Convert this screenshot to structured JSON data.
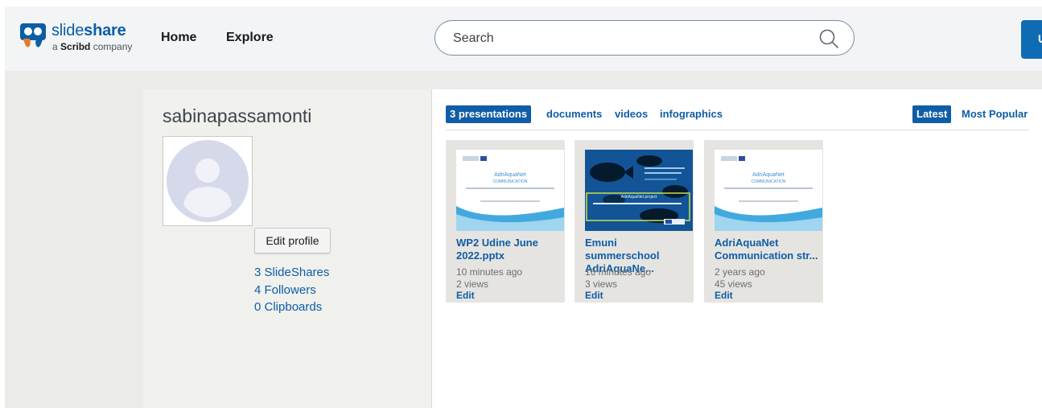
{
  "header": {
    "logo": {
      "brand_light": "slide",
      "brand_bold": "share",
      "sub_prefix": "a ",
      "sub_bold": "Scribd",
      "sub_suffix": " company"
    },
    "nav": [
      "Home",
      "Explore"
    ],
    "search": {
      "placeholder": "Search",
      "icon": "search-icon"
    },
    "upload_label": "U"
  },
  "profile": {
    "username": "sabinapassamonti",
    "edit_label": "Edit profile",
    "stats": [
      "3 SlideShares",
      "4 Followers",
      "0 Clipboards"
    ]
  },
  "tabs": {
    "content": [
      "3 presentations",
      "documents",
      "videos",
      "infographics"
    ],
    "active": "3 presentations",
    "sort": [
      "Latest",
      "Most Popular"
    ],
    "active_sort": "Latest"
  },
  "presentations": [
    {
      "title": "WP2 Udine June 2022.pptx",
      "time": "10 minutes ago",
      "views": "2 views",
      "action": "Edit",
      "thumb": {
        "style": "light",
        "heading": "AdriAquaNet",
        "subheading": "COMMUNICATION"
      }
    },
    {
      "title": "Emuni summerschool AdriAquaNe...",
      "time": "16 minutes ago",
      "views": "3 views",
      "action": "Edit",
      "thumb": {
        "style": "dark",
        "heading": "AdriAquaNet project"
      }
    },
    {
      "title": "AdriAquaNet Communication str...",
      "time": "2 years ago",
      "views": "45 views",
      "action": "Edit",
      "thumb": {
        "style": "light",
        "heading": "AdriAquaNet",
        "subheading": "COMMUNICATION"
      }
    }
  ],
  "colors": {
    "accent": "#0f5da6",
    "page_bg": "#ebebea",
    "header_bg": "#f2f4f6",
    "card_bg": "#e6e4e1"
  }
}
